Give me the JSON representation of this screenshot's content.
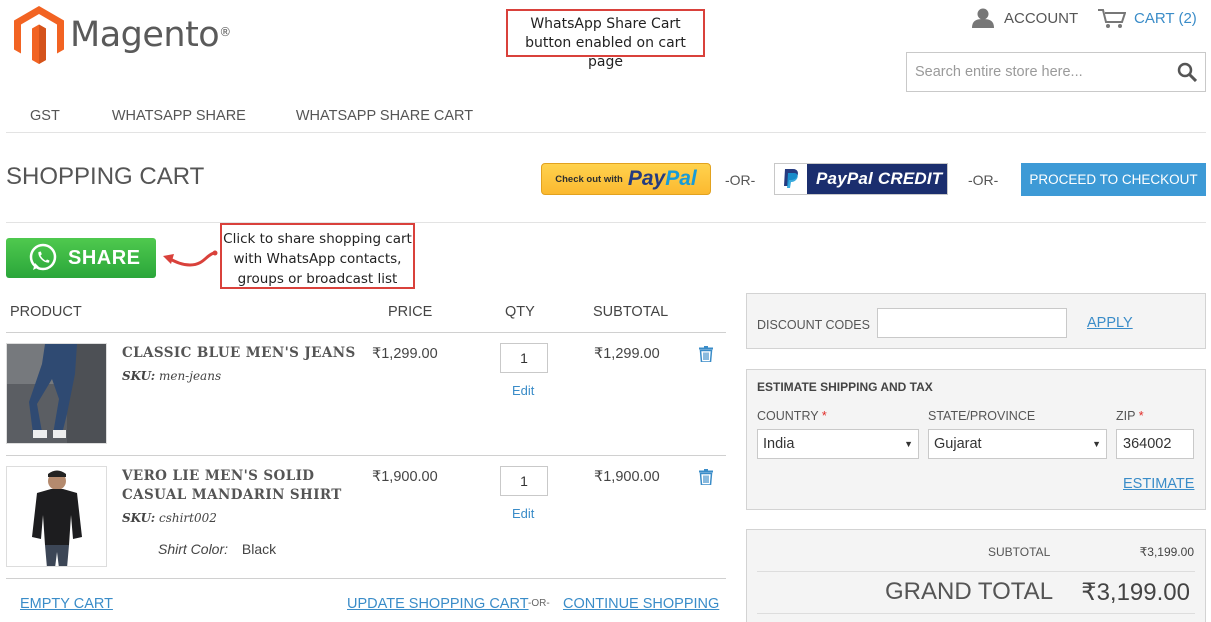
{
  "header": {
    "logo_text": "Magento",
    "logo_mark": "®",
    "account_label": "ACCOUNT",
    "cart_label": "CART (2)",
    "search_placeholder": "Search entire store here...",
    "annotation_top": "WhatsApp Share Cart button enabled on cart page"
  },
  "nav": {
    "items": [
      {
        "label": "GST"
      },
      {
        "label": "WHATSAPP SHARE"
      },
      {
        "label": "WHATSAPP SHARE CART"
      }
    ]
  },
  "page": {
    "title": "SHOPPING CART",
    "paypal_small": "Check out with",
    "paypal_pay": "Pay",
    "paypal_pal": "Pal",
    "or_label": "-OR-",
    "paypal_credit_label": "PayPal CREDIT",
    "checkout_label": "PROCEED TO CHECKOUT",
    "whatsapp_share_label": "SHARE",
    "annotation_share": "Click to share shopping cart with WhatsApp contacts, groups or broadcast list"
  },
  "cart": {
    "columns": {
      "product": "PRODUCT",
      "price": "PRICE",
      "qty": "QTY",
      "subtotal": "SUBTOTAL"
    },
    "items": [
      {
        "name_line1": "CLASSIC BLUE MEN'S JEANS",
        "name_line2": "",
        "sku_label": "SKU:",
        "sku": "men-jeans",
        "price": "₹1,299.00",
        "qty": "1",
        "edit_label": "Edit",
        "subtotal": "₹1,299.00"
      },
      {
        "name_line1": "VERO LIE MEN'S SOLID",
        "name_line2": "CASUAL MANDARIN SHIRT",
        "sku_label": "SKU:",
        "sku": "cshirt002",
        "price": "₹1,900.00",
        "qty": "1",
        "edit_label": "Edit",
        "subtotal": "₹1,900.00",
        "option_label": "Shirt Color:",
        "option_value": "Black"
      }
    ],
    "empty_label": "EMPTY CART",
    "update_label": "UPDATE SHOPPING CART",
    "or_small": "-OR-",
    "continue_label": "CONTINUE SHOPPING"
  },
  "summary": {
    "discount_label": "DISCOUNT CODES",
    "discount_value": "",
    "apply_label": "APPLY",
    "ship_title": "ESTIMATE SHIPPING AND TAX",
    "country_label": "COUNTRY",
    "country_value": "India",
    "state_label": "STATE/PROVINCE",
    "state_value": "Gujarat",
    "zip_label": "ZIP",
    "zip_value": "364002",
    "required_mark": "*",
    "estimate_label": "ESTIMATE",
    "subtotal_label": "SUBTOTAL",
    "subtotal_value": "₹3,199.00",
    "grand_total_label": "GRAND TOTAL",
    "grand_total_value": "₹3,199.00"
  },
  "colors": {
    "link": "#3a8cc8",
    "checkout_button": "#3d9ad6",
    "whatsapp_green": "#2fb13c",
    "annotation_border": "#d9413b",
    "magento_orange": "#f26322"
  }
}
